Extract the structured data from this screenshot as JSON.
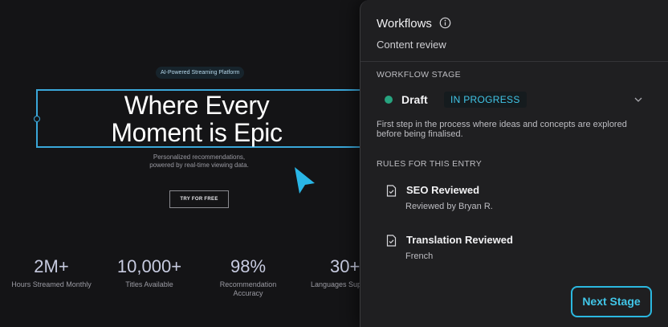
{
  "site": {
    "badge": "AI-Powered Streaming Platform",
    "hero_line1": "Where Every",
    "hero_line2": "Moment is Epic",
    "sub_line1": "Personalized recommendations,",
    "sub_line2": "powered by real-time viewing data.",
    "cta_label": "TRY FOR FREE",
    "stats": [
      {
        "value": "2M+",
        "label": "Hours Streamed Monthly"
      },
      {
        "value": "10,000+",
        "label": "Titles Available"
      },
      {
        "value": "98%",
        "label_line1": "Recommendation",
        "label_line2": "Accuracy"
      },
      {
        "value": "30+",
        "label": "Languages Sup"
      }
    ]
  },
  "panel": {
    "title": "Workflows",
    "info_icon": "info-circle-icon",
    "subtitle": "Content review",
    "stage_section_label": "WORKFLOW STAGE",
    "stage": {
      "name": "Draft",
      "status": "IN PROGRESS",
      "dot_color": "#27a37f",
      "description": "First step in the process where ideas and concepts are explored before being finalised."
    },
    "rules_section_label": "RULES FOR THIS ENTRY",
    "rules": [
      {
        "title": "SEO Reviewed",
        "meta": "Reviewed by Bryan R.",
        "icon": "document-check-icon"
      },
      {
        "title": "Translation Reviewed",
        "meta": "French",
        "icon": "document-check-icon"
      }
    ],
    "next_button": "Next Stage"
  },
  "colors": {
    "accent": "#41c6e8",
    "stage_dot": "#27a37f",
    "panel_bg": "#1f1f21",
    "site_bg": "#141416"
  }
}
